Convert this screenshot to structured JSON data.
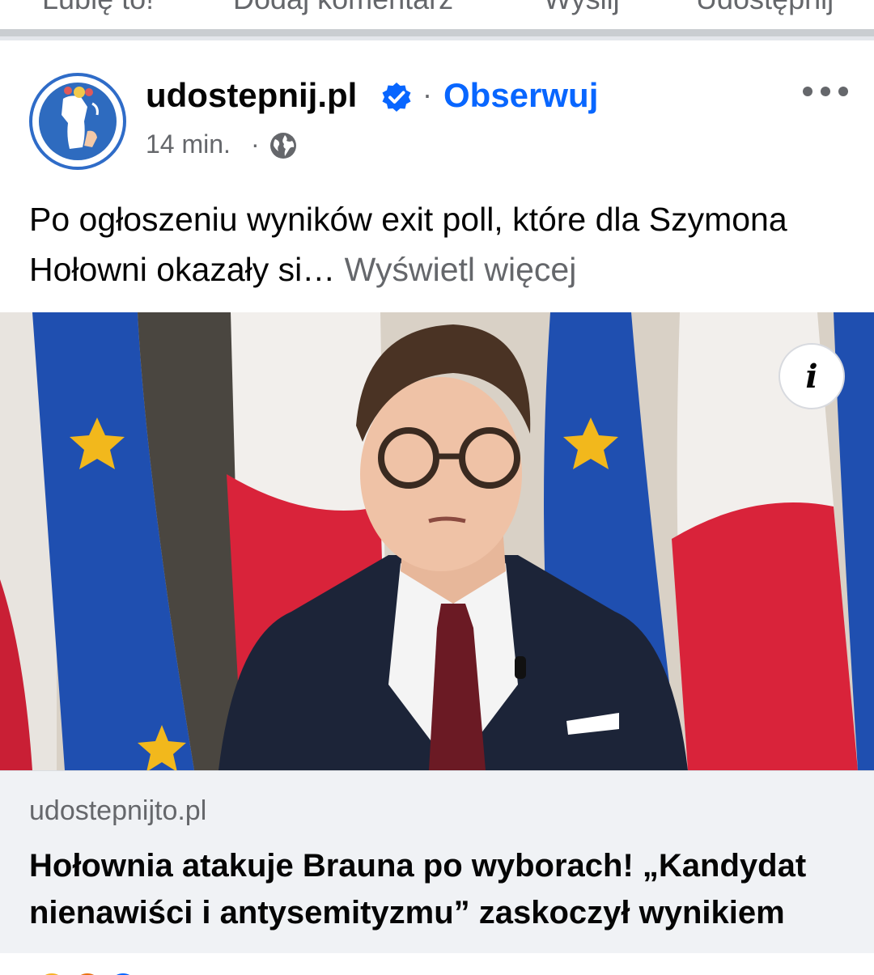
{
  "top_actions": [
    {
      "label": "Lubię to!"
    },
    {
      "label": "Dodaj komentarz"
    },
    {
      "label": "Wyślij"
    },
    {
      "label": "Udostępnij"
    }
  ],
  "post": {
    "page_name": "udostepnij.pl",
    "verified_icon": "verified-badge-icon",
    "separator": "·",
    "follow_label": "Obserwuj",
    "time": "14 min.",
    "meta_separator": "·",
    "audience_icon": "globe-icon",
    "more_icon": "more-horizontal-icon",
    "text": "Po ogłoszeniu wyników exit poll, które dla Szymona Hołowni okazały si…",
    "see_more": "Wyświetl więcej",
    "info_icon": "info-icon",
    "link": {
      "domain": "udostepnijto.pl",
      "title": "Hołownia atakuje Brauna po wyborach! „Kandydat nienawiści i antysemityzmu” zaskoczył wynikiem"
    }
  },
  "colors": {
    "accent": "#0866ff",
    "secondary_text": "#65676b",
    "verified": "#0866ff",
    "link_background": "#f0f2f5"
  }
}
